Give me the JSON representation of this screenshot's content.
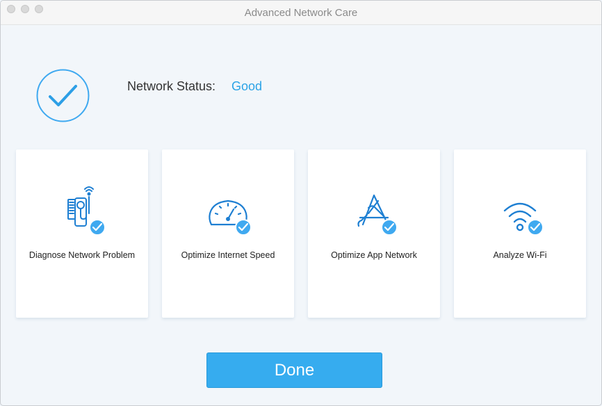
{
  "window": {
    "title": "Advanced Network Care"
  },
  "status": {
    "label": "Network Status:",
    "value": "Good"
  },
  "cards": [
    {
      "label": "Diagnose Network Problem",
      "icon": "stethoscope-router-icon",
      "checked": true
    },
    {
      "label": "Optimize Internet Speed",
      "icon": "speedometer-icon",
      "checked": true
    },
    {
      "label": "Optimize App Network",
      "icon": "app-store-tools-icon",
      "checked": true
    },
    {
      "label": "Analyze Wi-Fi",
      "icon": "wifi-icon",
      "checked": true
    }
  ],
  "actions": {
    "done_label": "Done"
  },
  "colors": {
    "accent": "#2ba3e6",
    "button": "#36acef",
    "icon": "#1e7fd2",
    "check_badge": "#3fa9f0"
  }
}
